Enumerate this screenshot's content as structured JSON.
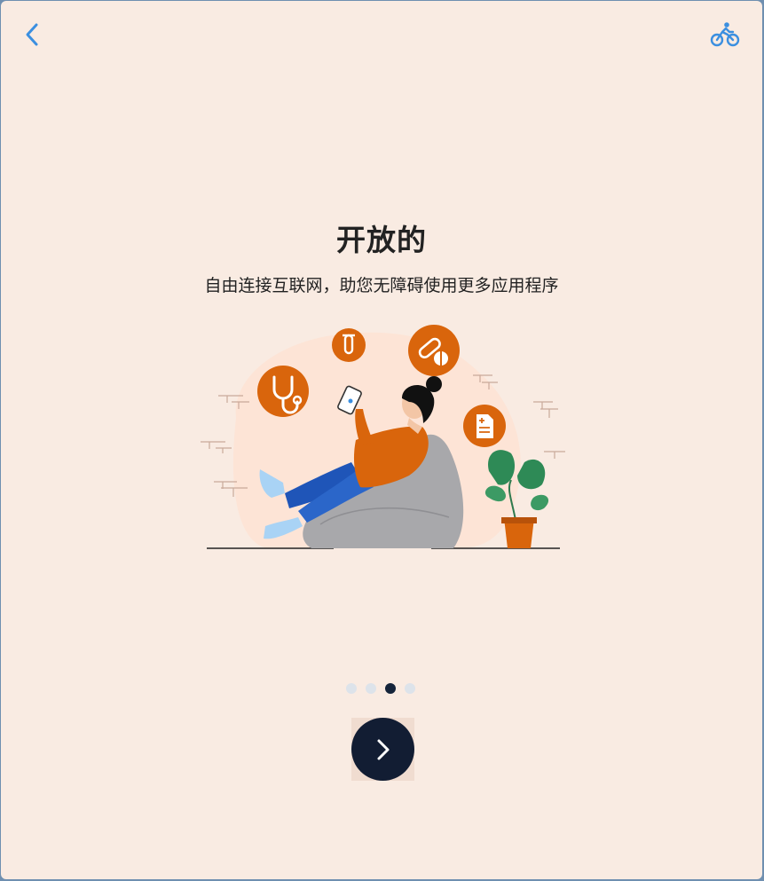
{
  "header": {
    "back_icon": "chevron-left-icon",
    "bike_icon": "bicycle-icon",
    "accent_color": "#3b8fe0"
  },
  "onboarding": {
    "title": "开放的",
    "subtitle": "自由连接互联网，助您无障碍使用更多应用程序",
    "illustration": "woman-on-beanbag-with-phone-and-health-icons",
    "illustration_color": "#d9650c"
  },
  "pagination": {
    "total_pages": 4,
    "current_page": 3
  },
  "next_button": {
    "icon": "chevron-right-icon",
    "color": "#121d33"
  }
}
